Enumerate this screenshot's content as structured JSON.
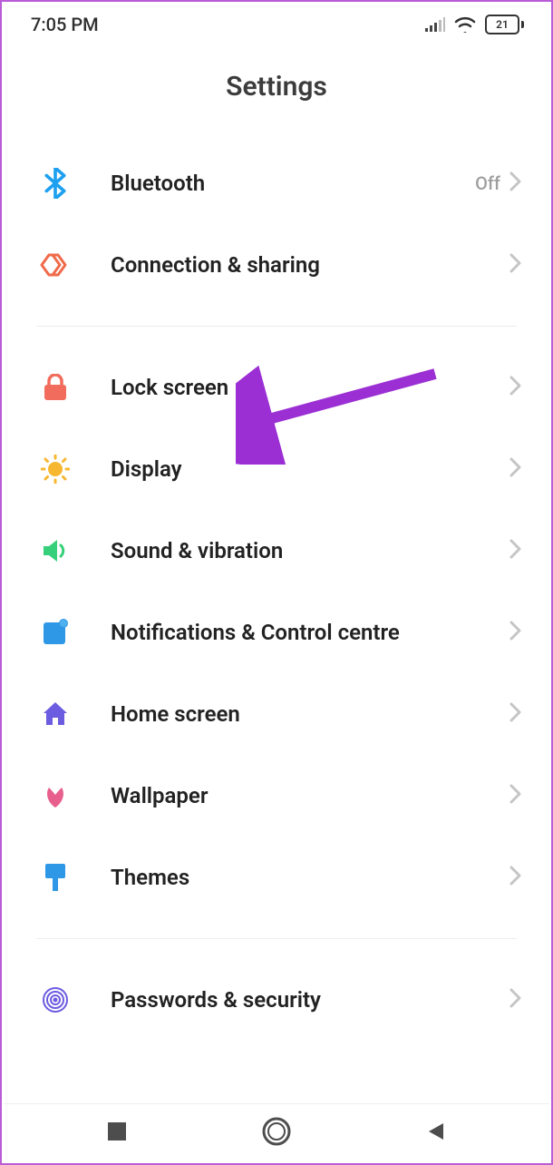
{
  "status": {
    "time": "7:05 PM",
    "battery": "21"
  },
  "title": "Settings",
  "sections": [
    [
      {
        "id": "bluetooth",
        "label": "Bluetooth",
        "trail": "Off",
        "icon": "bluetooth",
        "color": "#1ea0f0"
      },
      {
        "id": "connection",
        "label": "Connection & sharing",
        "icon": "connection",
        "color": "#f06a4a"
      }
    ],
    [
      {
        "id": "lockscreen",
        "label": "Lock screen",
        "icon": "lock",
        "color": "#f26c5d"
      },
      {
        "id": "display",
        "label": "Display",
        "icon": "sun",
        "color": "#f7b731"
      },
      {
        "id": "sound",
        "label": "Sound & vibration",
        "icon": "sound",
        "color": "#36d07a"
      },
      {
        "id": "notif",
        "label": "Notifications & Control centre",
        "icon": "notif",
        "color": "#2f98e6"
      },
      {
        "id": "home",
        "label": "Home screen",
        "icon": "home",
        "color": "#6b5ce0"
      },
      {
        "id": "wallpaper",
        "label": "Wallpaper",
        "icon": "flower",
        "color": "#e85f8d"
      },
      {
        "id": "themes",
        "label": "Themes",
        "icon": "brush",
        "color": "#2f98e6"
      }
    ],
    [
      {
        "id": "passwords",
        "label": "Passwords & security",
        "icon": "fingerprint",
        "color": "#6b5ce0"
      }
    ]
  ],
  "annotation": {
    "target": "lockscreen",
    "arrow_color": "#9b2fd4"
  }
}
